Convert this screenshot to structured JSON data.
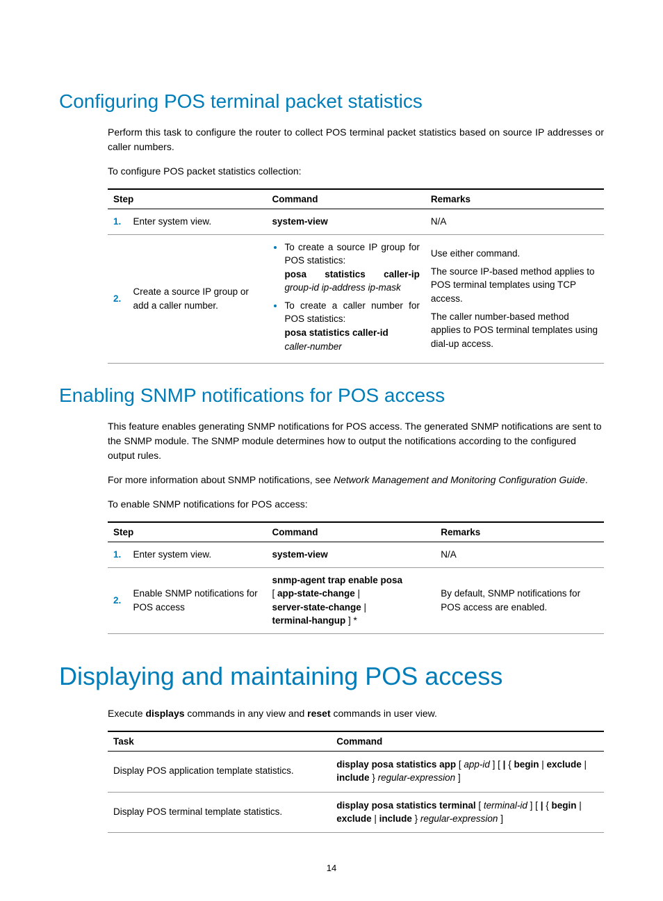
{
  "section1": {
    "heading": "Configuring POS terminal packet statistics",
    "para1": "Perform this task to configure the router to collect POS terminal packet statistics based on source IP addresses or caller numbers.",
    "para2": "To configure POS packet statistics collection:",
    "table": {
      "headers": {
        "step": "Step",
        "command": "Command",
        "remarks": "Remarks"
      },
      "rows": [
        {
          "num": "1.",
          "desc": "Enter system view.",
          "cmd_bold": "system-view",
          "remarks": "N/A"
        },
        {
          "num": "2.",
          "desc": "Create a source IP group or add a caller number.",
          "bullets": [
            {
              "intro": "To create a source IP group for POS statistics:",
              "cmd_bold": "posa statistics caller-ip",
              "cmd_italic": "group-id ip-address ip-mask"
            },
            {
              "intro": "To create a caller number for POS statistics:",
              "cmd_bold": "posa statistics caller-id",
              "cmd_italic": "caller-number"
            }
          ],
          "remarks_lines": [
            "Use either command.",
            "The source IP-based method applies to POS terminal templates using TCP access.",
            "The caller number-based method applies to POS terminal templates using dial-up access."
          ]
        }
      ]
    }
  },
  "section2": {
    "heading": "Enabling SNMP notifications for POS access",
    "para1": "This feature enables generating SNMP notifications for POS access. The generated SNMP notifications are sent to the SNMP module. The SNMP module determines how to output the notifications according to the configured output rules.",
    "para2_pre": "For more information about SNMP notifications, see ",
    "para2_italic": "Network Management and Monitoring Configuration Guide",
    "para2_post": ".",
    "para3": "To enable SNMP notifications for POS access:",
    "table": {
      "headers": {
        "step": "Step",
        "command": "Command",
        "remarks": "Remarks"
      },
      "rows": [
        {
          "num": "1.",
          "desc": "Enter system view.",
          "cmd_bold": "system-view",
          "remarks": "N/A"
        },
        {
          "num": "2.",
          "desc": "Enable SNMP notifications for POS access",
          "cmd_line1": "snmp-agent trap enable posa",
          "cmd_l2_a": "[ ",
          "cmd_l2_b": "app-state-change",
          "cmd_l2_c": " |",
          "cmd_l3_a": "server-state-change",
          "cmd_l3_b": " |",
          "cmd_l4_a": "terminal-hangup",
          "cmd_l4_b": " ] *",
          "remarks": "By default, SNMP notifications for POS access are enabled."
        }
      ]
    }
  },
  "section3": {
    "heading": "Displaying and maintaining POS access",
    "para1_a": "Execute ",
    "para1_b": "displays",
    "para1_c": " commands in any view and ",
    "para1_d": "reset",
    "para1_e": " commands in user view.",
    "table": {
      "headers": {
        "task": "Task",
        "command": "Command"
      },
      "rows": [
        {
          "task": "Display POS application template statistics.",
          "segments": [
            {
              "t": "display posa statistics app",
              "b": true
            },
            {
              "t": " [ "
            },
            {
              "t": "app-id",
              "i": true
            },
            {
              "t": " ] [ "
            },
            {
              "t": "|",
              "b": true
            },
            {
              "t": " { "
            },
            {
              "t": "begin",
              "b": true
            },
            {
              "t": " | "
            },
            {
              "t": "exclude",
              "b": true
            },
            {
              "t": " | "
            },
            {
              "t": "include",
              "b": true
            },
            {
              "t": " } "
            },
            {
              "t": "regular-expression",
              "i": true
            },
            {
              "t": " ]"
            }
          ]
        },
        {
          "task": "Display POS terminal template statistics.",
          "segments": [
            {
              "t": "display posa statistics terminal",
              "b": true
            },
            {
              "t": " [ "
            },
            {
              "t": "terminal-id",
              "i": true
            },
            {
              "t": " ] [ "
            },
            {
              "t": "|",
              "b": true
            },
            {
              "t": " { "
            },
            {
              "t": "begin",
              "b": true
            },
            {
              "t": " | "
            },
            {
              "t": "exclude",
              "b": true
            },
            {
              "t": " | "
            },
            {
              "t": "include",
              "b": true
            },
            {
              "t": " } "
            },
            {
              "t": "regular-expression",
              "i": true
            },
            {
              "t": " ]"
            }
          ]
        }
      ]
    }
  },
  "page_number": "14"
}
